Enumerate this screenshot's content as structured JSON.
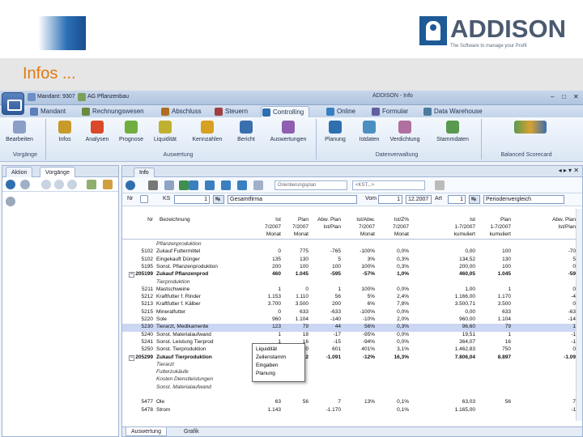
{
  "slide": {
    "title": "Infos ...",
    "brand": "ADDISON",
    "tagline": "The Software to manage your Profit"
  },
  "app": {
    "window_title": "ADDISON - Info",
    "qat": [
      {
        "label": "Mandant: 9307"
      },
      {
        "label": "AG Pflanzenbau"
      }
    ],
    "tabs": [
      {
        "label": "Mandant",
        "color": "#5e7fb8"
      },
      {
        "label": "Rechnungswesen",
        "color": "#6a8a40"
      },
      {
        "label": "Abschluss",
        "color": "#b06f20"
      },
      {
        "label": "Steuern",
        "color": "#a04040"
      },
      {
        "label": "Controlling",
        "color": "#2f6fb0",
        "active": true
      },
      {
        "label": "Online",
        "color": "#3a7fbf"
      },
      {
        "label": "Formular",
        "color": "#6060a0"
      },
      {
        "label": "Data Warehouse",
        "color": "#4d7b9f"
      }
    ],
    "ribbon": {
      "buttons": [
        {
          "label": "Bearbeiten",
          "icon": "edit-icon",
          "color": "#8a9fc7"
        },
        {
          "label": "Infos",
          "icon": "info-icon",
          "color": "#c79a2a"
        },
        {
          "label": "Analysen",
          "icon": "traffic-light-icon",
          "color": "#d94a2a"
        },
        {
          "label": "Prognose",
          "icon": "forecast-icon",
          "color": "#6fae3f"
        },
        {
          "label": "Liquidität",
          "icon": "liquidity-icon",
          "color": "#c0b030"
        },
        {
          "label": "Kennzahlen",
          "icon": "kpi-icon",
          "color": "#d8a020"
        },
        {
          "label": "Bericht",
          "icon": "report-icon",
          "color": "#3a6fb0"
        },
        {
          "label": "Auswertungen",
          "icon": "evaluations-icon",
          "color": "#8f5fb0"
        },
        {
          "label": "Planung",
          "icon": "planning-icon",
          "color": "#2f6fb0"
        },
        {
          "label": "Istdaten",
          "icon": "actual-data-icon",
          "color": "#4a8fc0"
        },
        {
          "label": "Verdichtung",
          "icon": "aggregation-icon",
          "color": "#b070a0"
        },
        {
          "label": "Stammdaten",
          "icon": "master-data-icon",
          "color": "#5a9a50"
        }
      ],
      "groups": [
        {
          "label": "Vorgänge"
        },
        {
          "label": "Auswertung"
        },
        {
          "label": "Datenverwaltung"
        },
        {
          "label": "Balanced Scorecard"
        }
      ]
    },
    "left_panel": {
      "tabs": [
        "Aktion",
        "Vorgänge"
      ]
    },
    "main": {
      "tab": "Info",
      "tab_controls": "◂ ▸ ▾ ✕",
      "combo1": "Orientierungsplan",
      "combo2": "<KST...>",
      "filter": {
        "nr_label": "Nr",
        "ks_label": "KS",
        "ks_value": "1",
        "ks_name": "Gesamtfirma",
        "from_label": "Vom",
        "from_value": "1",
        "to_value": "12.2007",
        "art_label": "Art",
        "art_value": "1",
        "art_name": "Periodenvergleich"
      },
      "headers": [
        {
          "l1": "Nr",
          "l2": "",
          "l3": ""
        },
        {
          "l1": "Bezeichnung",
          "l2": "",
          "l3": ""
        },
        {
          "l1": "Ist",
          "l2": "7/2007",
          "l3": "Monat"
        },
        {
          "l1": "Plan",
          "l2": "7/2007",
          "l3": "Monat"
        },
        {
          "l1": "Abw. Plan",
          "l2": "Ist/Plan",
          "l3": ""
        },
        {
          "l1": "Ist/Abw.",
          "l2": "7/2007",
          "l3": "Monat"
        },
        {
          "l1": "Ist/Z%",
          "l2": "7/2007",
          "l3": "Monat"
        },
        {
          "l1": "Ist",
          "l2": "1-7/2007",
          "l3": "kumuliert"
        },
        {
          "l1": "Plan",
          "l2": "1-7/2007",
          "l3": "kumuliert"
        },
        {
          "l1": "Abw. Plan",
          "l2": "Ist/Plan",
          "l3": ""
        }
      ],
      "rows": [
        {
          "nr": "",
          "name": "Pflanzenproduktion",
          "v": [
            "",
            "",
            "",
            "",
            "",
            "",
            "",
            ""
          ],
          "style": "it"
        },
        {
          "nr": "5102",
          "name": "Zukauf Futtermittel",
          "v": [
            "0",
            "775",
            "-765",
            "-100%",
            "0,0%",
            "0,00",
            "100",
            "-70"
          ]
        },
        {
          "nr": "5102",
          "name": "Eingekauft Dünger",
          "v": [
            "135",
            "130",
            "5",
            "3%",
            "0,3%",
            "134,52",
            "130",
            "5"
          ]
        },
        {
          "nr": "5195",
          "name": "Sonst. Pflanzenproduktion",
          "v": [
            "200",
            "100",
            "100",
            "100%",
            "0,3%",
            "200,00",
            "100",
            "0"
          ]
        },
        {
          "nr": "205199",
          "name": "Zukauf Pflanzenprod",
          "v": [
            "460",
            "1.045",
            "-595",
            "-57%",
            "1,0%",
            "460,05",
            "1.045",
            "-59"
          ],
          "style": "b"
        },
        {
          "nr": "",
          "name": "Tierproduktion",
          "v": [
            "",
            "",
            "",
            "",
            "",
            "",
            "",
            ""
          ],
          "style": "it"
        },
        {
          "nr": "5211",
          "name": "Mastschweine",
          "v": [
            "1",
            "0",
            "1",
            "100%",
            "0,0%",
            "1,00",
            "1",
            "0"
          ]
        },
        {
          "nr": "5212",
          "name": "Kraftfutter f. Rinder",
          "v": [
            "1.153",
            "1.110",
            "56",
            "5%",
            "2,4%",
            "1.166,00",
            "1.170",
            "-4"
          ]
        },
        {
          "nr": "5213",
          "name": "Kraftfutter f. Kälber",
          "v": [
            "3.700",
            "3.500",
            "200",
            "6%",
            "7,8%",
            "3.500,71",
            "3.500",
            "0"
          ]
        },
        {
          "nr": "5215",
          "name": "Mineralfutter",
          "v": [
            "0",
            "633",
            "-633",
            "-100%",
            "0,0%",
            "0,00",
            "633",
            "-63"
          ]
        },
        {
          "nr": "5220",
          "name": "Sole",
          "v": [
            "960",
            "1.104",
            "-140",
            "-10%",
            "2,0%",
            "960,00",
            "1.104",
            "-14"
          ]
        },
        {
          "nr": "5230",
          "name": "Tierarzt, Medikamente",
          "v": [
            "123",
            "79",
            "44",
            "56%",
            "0,3%",
            "96,60",
            "79",
            "1"
          ],
          "style": "sel"
        },
        {
          "nr": "5240",
          "name": "Sonst. Materialaufwand",
          "v": [
            "1",
            "18",
            "-17",
            "-95%",
            "0,0%",
            "19,51",
            "1",
            "-1"
          ]
        },
        {
          "nr": "5241",
          "name": "Sonst. Leistung Tierprod",
          "v": [
            "1",
            "16",
            "-15",
            "-94%",
            "0,0%",
            "364,07",
            "16",
            "-1"
          ]
        },
        {
          "nr": "5250",
          "name": "Sonst. Tierproduktion",
          "v": [
            "751",
            "150",
            "601",
            "401%",
            "3,1%",
            "1.462,83",
            "750",
            "0"
          ]
        },
        {
          "nr": "205299",
          "name": "Zukauf Tierproduktion",
          "v": [
            "7.801",
            "8.892",
            "-1.091",
            "-12%",
            "16,3%",
            "7.806,04",
            "8.897",
            "-1.09"
          ],
          "style": "b"
        },
        {
          "nr": "",
          "name": "Tierarzt",
          "v": [
            "",
            "",
            "",
            "",
            "",
            "",
            "",
            ""
          ],
          "style": "it"
        },
        {
          "nr": "",
          "name": "Futterzukäufe",
          "v": [
            "",
            "",
            "",
            "",
            "",
            "",
            "",
            ""
          ],
          "style": "it"
        },
        {
          "nr": "",
          "name": "Kosten Dienstleistungen",
          "v": [
            "",
            "",
            "",
            "",
            "",
            "",
            "",
            ""
          ],
          "style": "it"
        },
        {
          "nr": "",
          "name": "Sonst. Materialaufwand",
          "v": [
            "",
            "",
            "",
            "",
            "",
            "",
            "",
            ""
          ],
          "style": "it"
        },
        {
          "nr": "",
          "name": "",
          "v": [
            "",
            "",
            "",
            "",
            "",
            "",
            "",
            ""
          ]
        },
        {
          "nr": "5477",
          "name": "Öle",
          "v": [
            "63",
            "56",
            "7",
            "13%",
            "0,1%",
            "63,03",
            "56",
            "7"
          ]
        },
        {
          "nr": "5478",
          "name": "Strom",
          "v": [
            "1.143",
            "",
            "-1.170",
            "",
            "0,1%",
            "1.165,00",
            "",
            "-1"
          ]
        }
      ],
      "popup": [
        "Liquidität",
        "Zeilenstamm",
        "Eingaben",
        "Planung"
      ],
      "bottom_tabs": [
        "Auswertung",
        "Grafik"
      ]
    }
  }
}
